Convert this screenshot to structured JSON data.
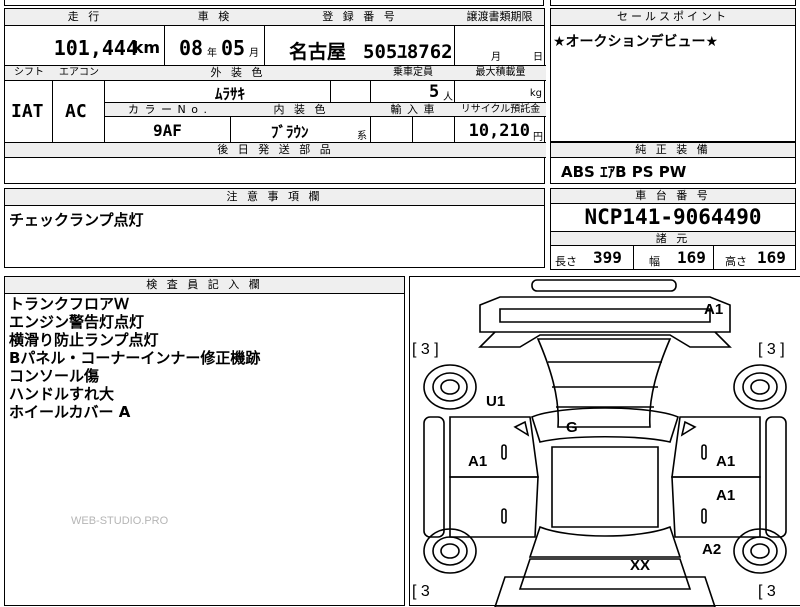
{
  "top": {
    "mileage": {
      "label": "走 行",
      "value": "101,444",
      "unit": "km"
    },
    "inspection": {
      "label": "車 検",
      "year": "08",
      "year_unit": "年",
      "month": "05",
      "month_unit": "月"
    },
    "registration": {
      "label": "登 録 番 号",
      "city": "名古屋",
      "number": "505ﾕ8762"
    },
    "transfer": {
      "label": "譲渡書類期限",
      "month_unit": "月",
      "day_unit": "日"
    },
    "selling_points": {
      "label": "セールスポイント",
      "text": "★オークションデビュー★"
    }
  },
  "spec": {
    "shift": {
      "label": "シフト",
      "value": "IAT"
    },
    "aircon": {
      "label": "エアコン",
      "value": "AC"
    },
    "exterior_color": {
      "label": "外 装 色",
      "value": "ﾑﾗｻｷ"
    },
    "capacity": {
      "label": "乗車定員",
      "value": "5",
      "unit": "人"
    },
    "max_load": {
      "label": "最大積載量",
      "unit": "kg"
    },
    "color_no": {
      "label": "カ ラ ー N o .",
      "value": "9AF"
    },
    "interior_color": {
      "label": "内 装 色",
      "value": "ﾌﾞﾗｳﾝ",
      "suffix": "系"
    },
    "import": {
      "label": "輸 入 車"
    },
    "recycle": {
      "label": "リサイクル預託金",
      "value": "10,210",
      "unit": "円"
    },
    "later_parts": {
      "label": "後 日 発 送 部 品"
    }
  },
  "equipment": {
    "label": "純 正 装 備",
    "value": "ABS ｴｱB PS PW"
  },
  "notes": {
    "label": "注 意 事 項 欄",
    "text": "チェックランプ点灯"
  },
  "chassis": {
    "label": "車 台 番 号",
    "value": "NCP141-9064490",
    "dims_label": "諸 元",
    "length_label": "長さ",
    "length": "399",
    "width_label": "幅",
    "width": "169",
    "height_label": "高さ",
    "height": "169"
  },
  "inspector": {
    "label": "検 査 員 記 入 欄",
    "lines": [
      "トランクフロアＷ",
      "エンジン警告灯点灯",
      "横滑り防止ランプ点灯",
      "Bパネル・コーナーインナー修正機跡",
      "コンソール傷",
      "ハンドルすれ大",
      "ホイールカバー A"
    ]
  },
  "diagram": {
    "marks": {
      "a1_top": "A1",
      "u1": "U1",
      "g": "G",
      "a1_left": "A1",
      "a1_right_1": "A1",
      "a1_right_2": "A1",
      "a2": "A2",
      "xx": "XX"
    },
    "tires": {
      "fl": "[ 3 ]",
      "fr": "[ 3 ]",
      "rl": "[ 3",
      "rr": "[ 3"
    }
  },
  "watermark": "WEB-STUDIO.PRO"
}
